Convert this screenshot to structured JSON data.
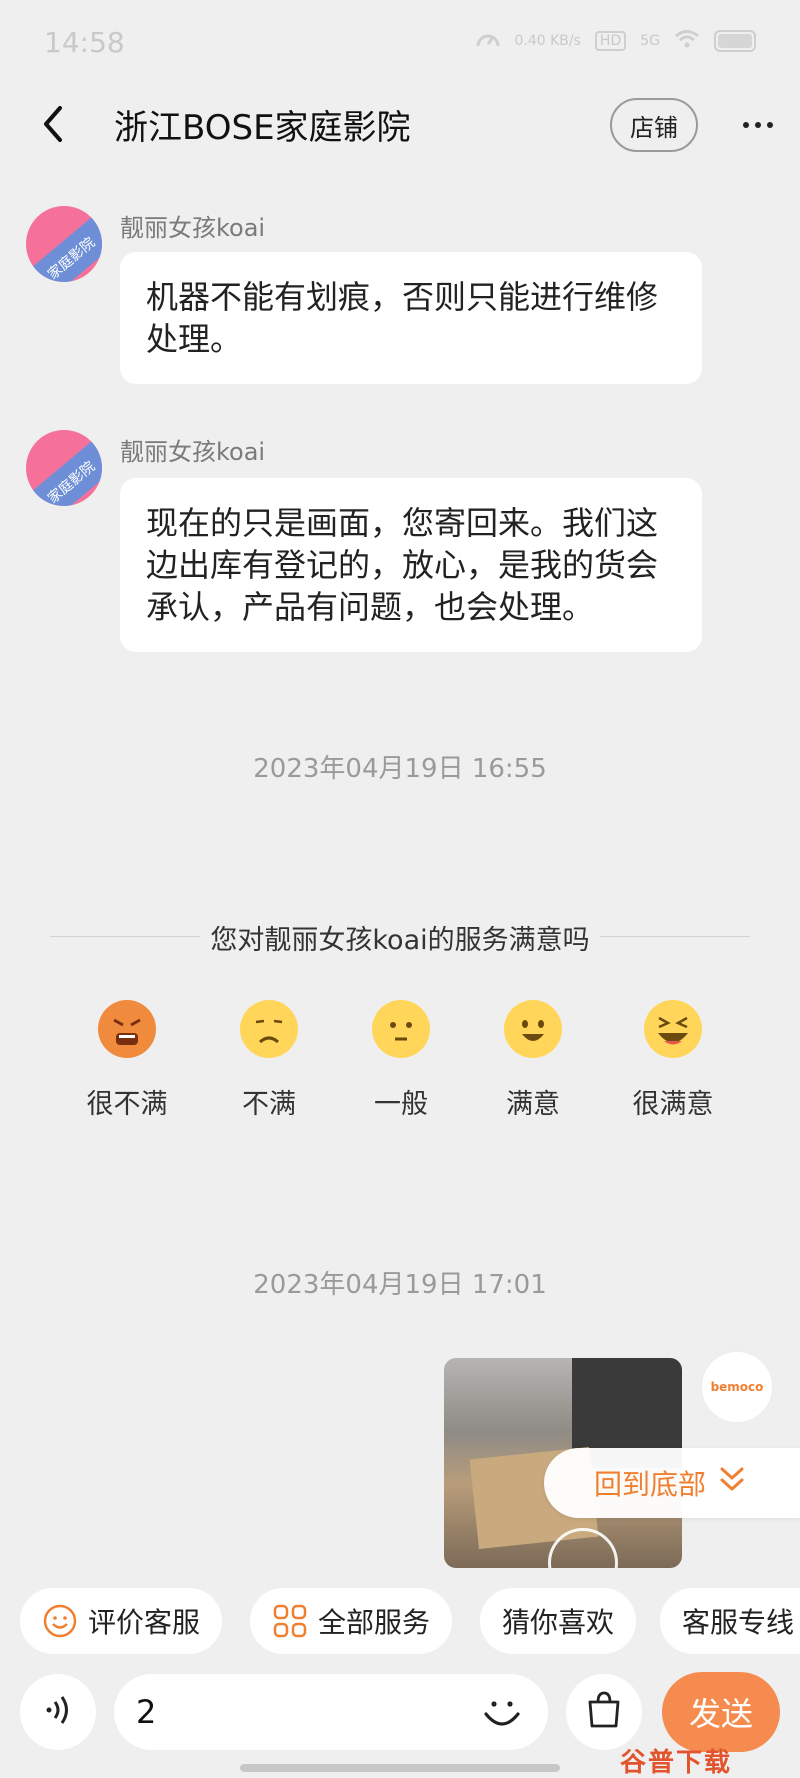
{
  "status_bar": {
    "time": "14:58",
    "net_speed": "0.40 KB/s",
    "hd": "HD",
    "signal": "5G"
  },
  "header": {
    "title": "浙江BOSE家庭影院",
    "shop_button": "店铺"
  },
  "messages": [
    {
      "sender": "靓丽女孩koai",
      "avatar_text": "家庭影院",
      "text": "机器不能有划痕，否则只能进行维修处理。"
    },
    {
      "sender": "靓丽女孩koai",
      "avatar_text": "家庭影院",
      "text": "现在的只是画面，您寄回来。我们这边出库有登记的，放心，是我的货会承认，产品有问题，也会处理。"
    }
  ],
  "timestamps": [
    "2023年04月19日 16:55",
    "2023年04月19日 17:01"
  ],
  "survey": {
    "title": "您对靓丽女孩koai的服务满意吗",
    "options": [
      {
        "label": "很不满",
        "icon": "very-angry-face-icon",
        "color": "#f08a3c"
      },
      {
        "label": "不满",
        "icon": "sad-face-icon",
        "color": "#ffd65a"
      },
      {
        "label": "一般",
        "icon": "neutral-face-icon",
        "color": "#ffd65a"
      },
      {
        "label": "满意",
        "icon": "smile-face-icon",
        "color": "#ffd65a"
      },
      {
        "label": "很满意",
        "icon": "laughing-face-icon",
        "color": "#ffd65a"
      }
    ]
  },
  "my_avatar_text": "bemoco",
  "back_to_bottom": "回到底部",
  "quick_chips": [
    {
      "label": "评价客服",
      "icon": "smiley-icon"
    },
    {
      "label": "全部服务",
      "icon": "grid-icon"
    },
    {
      "label": "猜你喜欢",
      "icon": ""
    },
    {
      "label": "客服专线",
      "icon": ""
    }
  ],
  "input": {
    "value": "2"
  },
  "send_button": "发送",
  "watermark": "谷普下载",
  "colors": {
    "accent": "#f68b4f",
    "link": "#f08030",
    "background": "#efefef"
  }
}
